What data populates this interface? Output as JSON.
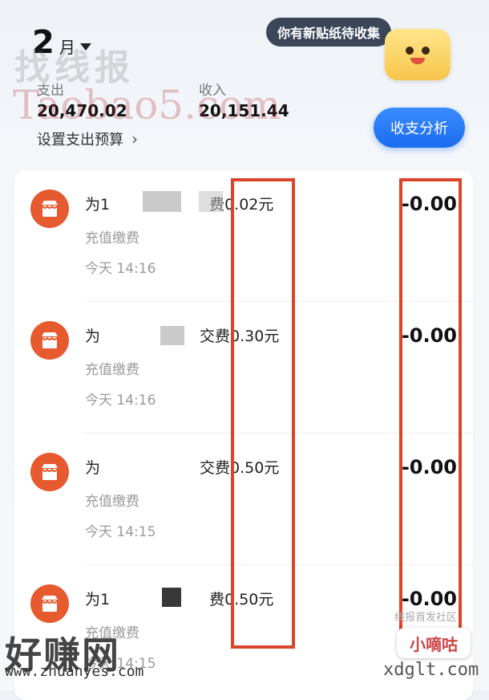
{
  "header": {
    "month": "2",
    "month_unit": "月",
    "expense_label": "支出",
    "expense_value": "20,470.02",
    "income_label": "收入",
    "income_value": "20,151.44",
    "budget_link": "设置支出预算",
    "sticker_bubble": "你有新贴纸待收集",
    "analysis_button": "收支分析"
  },
  "transactions": [
    {
      "title": "为1",
      "title_suffix": "费0.02元",
      "category": "充值缴费",
      "time": "今天 14:16",
      "amount": "-0.00"
    },
    {
      "title": "为",
      "title_suffix": "交费0.30元",
      "category": "充值缴费",
      "time": "今天 14:16",
      "amount": "-0.00"
    },
    {
      "title": "为",
      "title_suffix": "交费0.50元",
      "category": "充值缴费",
      "time": "今天 14:15",
      "amount": "-0.00"
    },
    {
      "title": "为1",
      "title_suffix": "费0.50元",
      "category": "充值缴费",
      "time": "今天 14:15",
      "amount": "-0.00"
    }
  ],
  "watermarks": {
    "top": "找线报",
    "taobao": "Taobao5.com",
    "haozhuan": "好赚网",
    "haozhuan_url": "www.zhuanyes.com",
    "community": "线报首发社区",
    "xiaodigu": "小嘀咕",
    "xdglt": "xdglt.com"
  },
  "colors": {
    "accent_blue": "#1c6cf0",
    "icon_orange": "#e65a2f",
    "highlight_red": "#d9442a"
  }
}
